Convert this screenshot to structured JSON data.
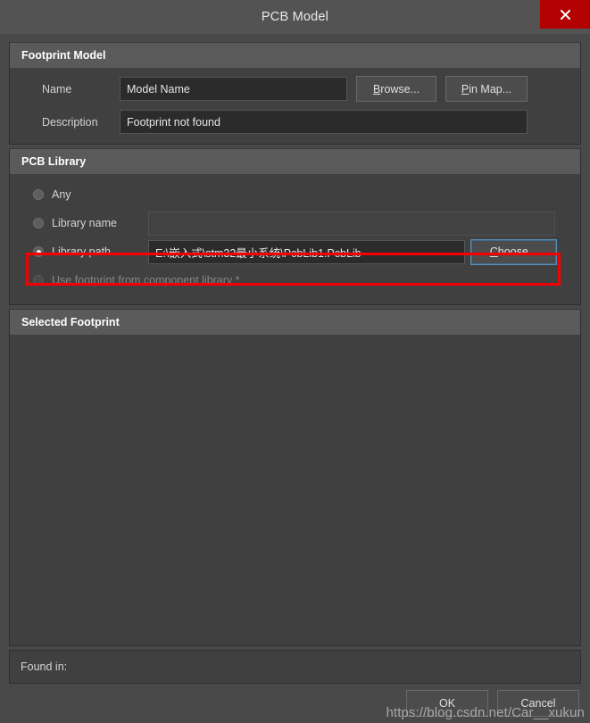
{
  "window": {
    "title": "PCB Model",
    "close_icon": "close-x-icon",
    "close_color": "#b30000"
  },
  "footprint_model": {
    "header": "Footprint Model",
    "name_label": "Name",
    "name_value": "Model Name",
    "description_label": "Description",
    "description_value": "Footprint not found",
    "browse_button": "Browse...",
    "browse_accel": "B",
    "browse_rest": "rowse...",
    "pin_map_button": "Pin Map...",
    "pin_map_accel": "P",
    "pin_map_rest": "in Map..."
  },
  "pcb_library": {
    "header": "PCB Library",
    "options": [
      {
        "label": "Any",
        "checked": false,
        "disabled": false
      },
      {
        "label": "Library name",
        "checked": false,
        "disabled": false
      },
      {
        "label": "Library path",
        "checked": true,
        "disabled": false
      },
      {
        "label": "Use footprint from component library *",
        "checked": false,
        "disabled": true
      }
    ],
    "library_name_value": "",
    "library_name_placeholder": "",
    "library_path_value": "E:\\嵌入式\\stm32最小系统\\PcbLib1.PcbLib",
    "choose_button": "Choose...",
    "choose_accel": "C",
    "choose_rest": "hoose...",
    "highlight_color": "#f40000"
  },
  "selected_footprint": {
    "header": "Selected Footprint",
    "content": ""
  },
  "found_in": {
    "label": "Found in:",
    "value": ""
  },
  "footer": {
    "ok_button": "OK",
    "cancel_button": "Cancel"
  },
  "watermark": {
    "text": "https://blog.csdn.net/Car__xukun"
  }
}
